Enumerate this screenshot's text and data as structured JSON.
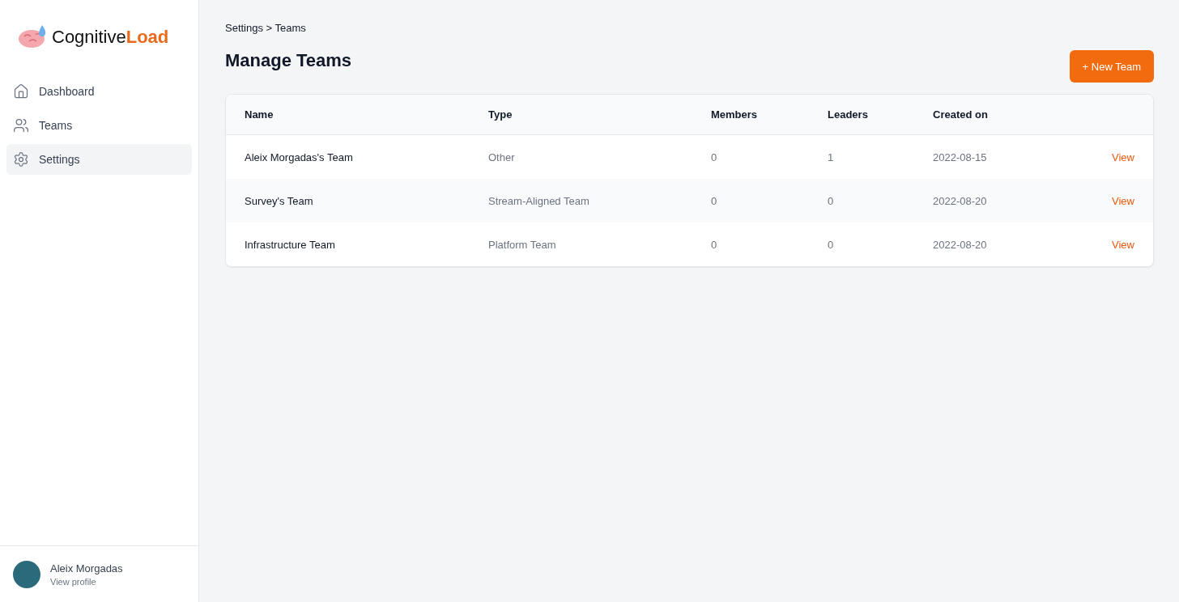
{
  "logo": {
    "first": "Cognitive",
    "second": "Load"
  },
  "nav": [
    {
      "label": "Dashboard",
      "selected": false
    },
    {
      "label": "Teams",
      "selected": false
    },
    {
      "label": "Settings",
      "selected": true
    }
  ],
  "profile": {
    "name": "Aleix Morgadas",
    "link": "View profile"
  },
  "breadcrumb": "Settings > Teams",
  "title": "Manage Teams",
  "new_button": "+ New Team",
  "table": {
    "columns": [
      "Name",
      "Type",
      "Members",
      "Leaders",
      "Created on"
    ],
    "rows": [
      {
        "name": "Aleix Morgadas's Team",
        "type": "Other",
        "members": "0",
        "leaders": "1",
        "created": "2022-08-15",
        "action": "View"
      },
      {
        "name": "Survey's Team",
        "type": "Stream-Aligned Team",
        "members": "0",
        "leaders": "0",
        "created": "2022-08-20",
        "action": "View"
      },
      {
        "name": "Infrastructure Team",
        "type": "Platform Team",
        "members": "0",
        "leaders": "0",
        "created": "2022-08-20",
        "action": "View"
      }
    ]
  }
}
